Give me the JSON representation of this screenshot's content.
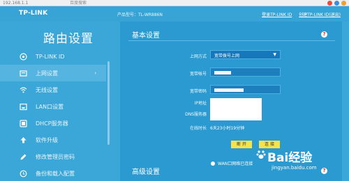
{
  "browser": {
    "url": "192.168.1.1",
    "tabs": [
      "",
      "百度搜索"
    ]
  },
  "header": {
    "logo": "TP-LINK",
    "model": "产品型号：TL-WR886N",
    "links": [
      "登录TP-LINK ID",
      "创建TP-LINK ID",
      "(退出)"
    ]
  },
  "sidebar": {
    "title": "路由设置",
    "items": [
      {
        "label": "TP-LINK ID",
        "icon": "cloud-id-icon"
      },
      {
        "label": "上网设置",
        "icon": "internet-icon",
        "active": true
      },
      {
        "label": "无线设置",
        "icon": "wifi-icon"
      },
      {
        "label": "LAN口设置",
        "icon": "lan-icon"
      },
      {
        "label": "DHCP服务器",
        "icon": "dhcp-icon"
      },
      {
        "label": "软件升级",
        "icon": "upgrade-icon"
      },
      {
        "label": "修改管理员密码",
        "icon": "edit-icon"
      },
      {
        "label": "备份和载入配置",
        "icon": "backup-icon"
      }
    ],
    "active_arrow": "›"
  },
  "basic": {
    "title": "基本设置",
    "help": "?",
    "fields": {
      "wan_type_label": "上网方式",
      "wan_type_value": "宽带拨号上网",
      "account_label": "宽带帐号",
      "password_label": "宽带密码",
      "ip_label": "IP地址",
      "dns_label": "DNS服务器",
      "online_label": "在线时长",
      "online_value": "6天23小时19分钟"
    },
    "connect_button": "断 开",
    "save_button": "连 接",
    "radio_label": "WAN口网络已连接"
  },
  "advanced": {
    "title": "高级设置",
    "help": "?"
  },
  "watermark": {
    "main_prefix": "Bai",
    "main_suffix": "经验",
    "sub": "jingyan.baidu.com"
  },
  "colors": {
    "background": "#3ba7d8",
    "panel": "#2a9ad1",
    "button": "#f6e34a",
    "help": "#e0352b"
  }
}
